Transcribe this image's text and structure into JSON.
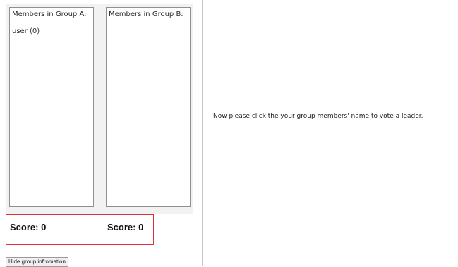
{
  "groups": {
    "a": {
      "title": "Members in Group A:",
      "members": [
        "user (0)"
      ],
      "score": "Score: 0"
    },
    "b": {
      "title": "Members in Group B:",
      "members": [],
      "score": "Score: 0"
    }
  },
  "buttons": {
    "hide_group_info": "Hide group infromation"
  },
  "main": {
    "instruction": "Now please click the your group members' name to vote a leader."
  },
  "colors": {
    "score_border": "#e0303a",
    "group_area_bg": "#f2f2f2"
  }
}
